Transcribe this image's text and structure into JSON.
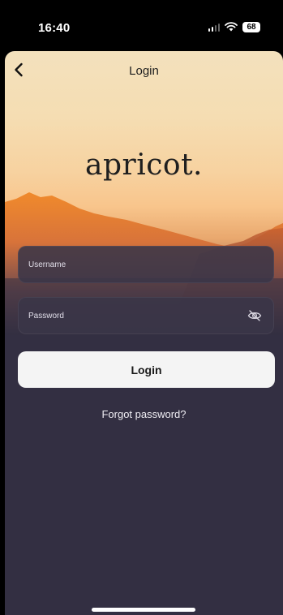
{
  "status_bar": {
    "time": "16:40",
    "battery": "68",
    "icons": [
      "signal-icon",
      "wifi-icon",
      "battery-icon"
    ]
  },
  "nav": {
    "title": "Login",
    "back_icon": "chevron-left-icon"
  },
  "brand": {
    "logo_text": "apricot."
  },
  "form": {
    "username_placeholder": "Username",
    "username_value": "",
    "password_placeholder": "Password",
    "password_value": "",
    "password_toggle_icon": "eye-off-icon",
    "login_label": "Login",
    "forgot_label": "Forgot password?"
  },
  "colors": {
    "background": "#332f42",
    "sky_top": "#f3e1bd",
    "mountain_orange": "#e77a2a",
    "button_bg": "#f4f4f4"
  }
}
